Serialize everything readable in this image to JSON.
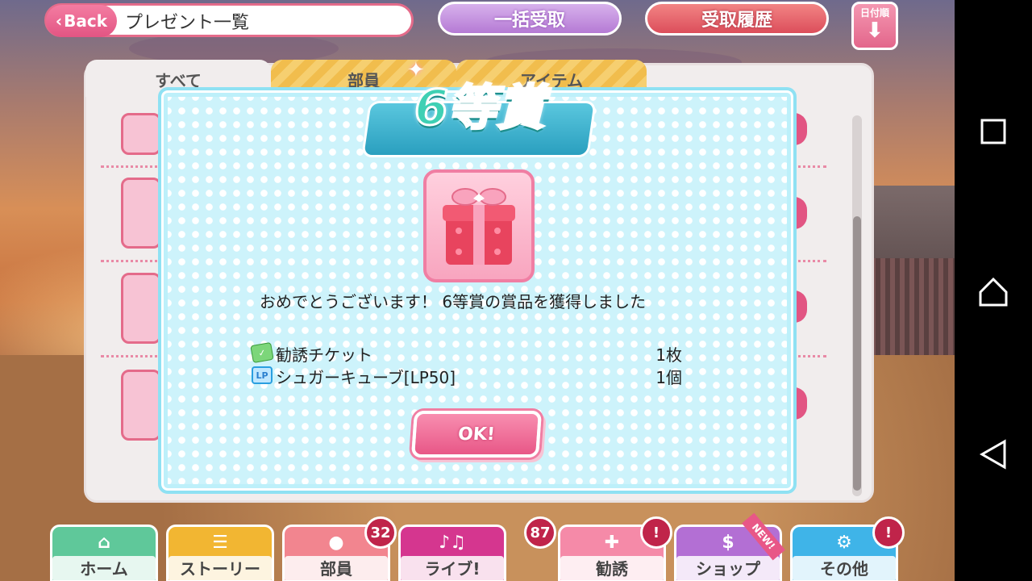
{
  "header": {
    "back_label": "Back",
    "title": "プレゼント一覧",
    "bulk_receive_label": "一括受取",
    "history_label": "受取履歴",
    "sort_label": "日付順",
    "sort_icon": "down-arrow-icon"
  },
  "tabs": [
    {
      "label": "すべて"
    },
    {
      "label": "部員"
    },
    {
      "label": "アイテム"
    }
  ],
  "modal": {
    "title": "6等賞",
    "congrats_text": "おめでとうございます！ 6等賞の賞品を獲得しました",
    "prizes": [
      {
        "icon": "ticket-icon",
        "name": "勧誘チケット",
        "qty": "1枚"
      },
      {
        "icon": "lp-icon",
        "icon_text": "LP",
        "name": "シュガーキューブ[LP50]",
        "qty": "1個"
      }
    ],
    "ok_label": "OK!"
  },
  "bottom_nav": [
    {
      "label": "ホーム",
      "icon": "home-icon",
      "color": "#5fc89a"
    },
    {
      "label": "ストーリー",
      "icon": "chat-icon",
      "color": "#f2b632"
    },
    {
      "label": "部員",
      "icon": "member-icon",
      "color": "#f2858f",
      "badge": "32"
    },
    {
      "label": "ライブ!",
      "icon": "music-icon",
      "color": "#d5368f",
      "badge": "87"
    },
    {
      "label": "勧誘",
      "icon": "recruit-icon",
      "color": "#f58aa8",
      "badge": "!"
    },
    {
      "label": "ショップ",
      "icon": "dollar-icon",
      "color": "#b36fd4",
      "ribbon": "NEW!"
    },
    {
      "label": "その他",
      "icon": "gear-icon",
      "color": "#3fb4e8",
      "badge": "!"
    }
  ],
  "colors": {
    "accent_pink": "#e85787",
    "modal_bg": "#cdf3fb",
    "badge_red": "#c0244a"
  }
}
